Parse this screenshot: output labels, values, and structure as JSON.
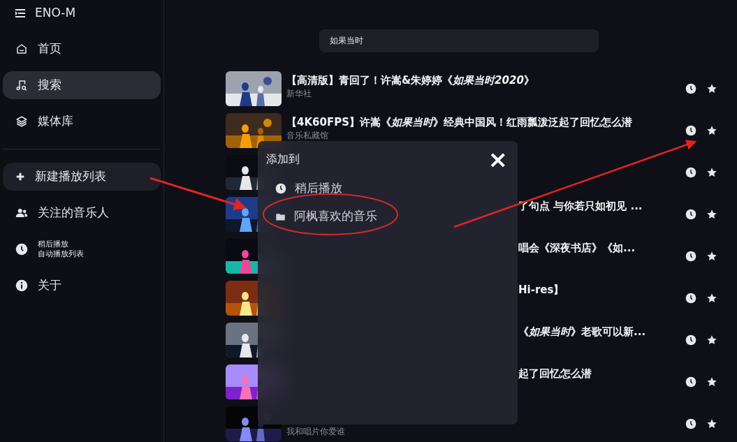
{
  "app_title": "ENO-M",
  "sidebar": {
    "items": [
      {
        "kind": "nav",
        "label": "首页",
        "selected": false
      },
      {
        "kind": "nav",
        "label": "搜索",
        "selected": true
      },
      {
        "kind": "nav",
        "label": "媒体库",
        "selected": false
      },
      {
        "kind": "divider"
      },
      {
        "kind": "button",
        "label": "新建播放列表"
      },
      {
        "kind": "nav",
        "label": "关注的音乐人",
        "selected": false
      },
      {
        "kind": "double",
        "label": "稍后播放",
        "sublabel": "自动播放列表",
        "selected": false
      },
      {
        "kind": "nav",
        "label": "关于",
        "selected": false
      }
    ]
  },
  "search": {
    "value": "如果当时"
  },
  "results": [
    {
      "kind": "full",
      "title": "【高清版】青回了！许嵩&朱婷婷《*如果当时2020*》",
      "subtitle": "新华社"
    },
    {
      "kind": "full",
      "title": "【4K60FPS】许嵩《*如果当时*》经典中国风！红雨瓢泼泛起了回忆怎么潜",
      "subtitle": "音乐私藏馆"
    },
    {
      "kind": "covered"
    },
    {
      "kind": "covered",
      "title": "了句点 与你若只如初见 ..."
    },
    {
      "kind": "covered",
      "title": "唱会《深夜书店》《如..."
    },
    {
      "kind": "covered",
      "title": "Hi-res】"
    },
    {
      "kind": "covered",
      "title": "《*如果当时*》老歌可以新..."
    },
    {
      "kind": "covered",
      "title": "起了回忆怎么潜"
    },
    {
      "kind": "covered",
      "subtitle": "我和唱片你爱谁"
    }
  ],
  "dialog": {
    "title": "添加到",
    "close": "×",
    "items": [
      {
        "label": "稍后播放"
      },
      {
        "label": "阿枫喜欢的音乐"
      }
    ]
  }
}
